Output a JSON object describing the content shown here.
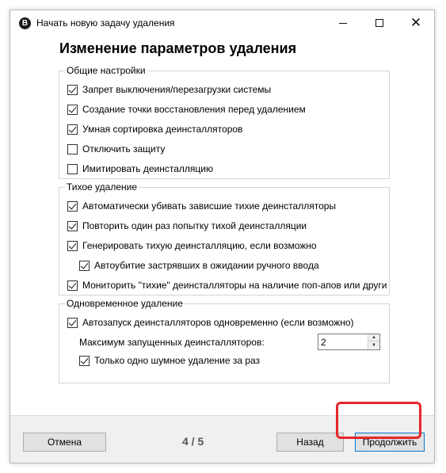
{
  "window": {
    "title": "Начать новую задачу удаления",
    "app_icon_letter": "B"
  },
  "heading": "Изменение параметров удаления",
  "groups": {
    "general": {
      "title": "Общие настройки",
      "options": [
        {
          "label": "Запрет выключения/перезагрузки системы",
          "checked": true
        },
        {
          "label": "Создание точки восстановления перед удалением",
          "checked": true
        },
        {
          "label": "Умная сортировка деинсталляторов",
          "checked": true
        },
        {
          "label": "Отключить защиту",
          "checked": false
        },
        {
          "label": "Имитировать деинсталляцию",
          "checked": false
        }
      ]
    },
    "quiet": {
      "title": "Тихое удаление",
      "options": [
        {
          "label": "Автоматически убивать зависшие тихие деинсталляторы",
          "checked": true
        },
        {
          "label": "Повторить один раз попытку тихой деинсталляции",
          "checked": true
        },
        {
          "label": "Генерировать тихую деинсталляцию, если возможно",
          "checked": true
        },
        {
          "label": "Автоубитие застрявших в ожидании ручного ввода",
          "checked": true
        },
        {
          "label": "Мониторить \"тихие\" деинсталляторы на наличие поп-апов или други",
          "checked": true
        }
      ]
    },
    "concurrent": {
      "title": "Одновременное удаление",
      "autostart": {
        "label": "Автозапуск деинсталляторов одновременно (если возможно)",
        "checked": true
      },
      "max_label": "Максимум запущенных деинсталляторов:",
      "max_value": "2",
      "single_noisy": {
        "label": "Только одно шумное удаление за раз",
        "checked": true
      }
    }
  },
  "footer": {
    "cancel_label": "Отмена",
    "page_indicator": "4 / 5",
    "back_label": "Назад",
    "next_label": "Продолжить"
  },
  "colors": {
    "highlight": "#e8262a",
    "footer_bg": "#f0f0f0"
  }
}
